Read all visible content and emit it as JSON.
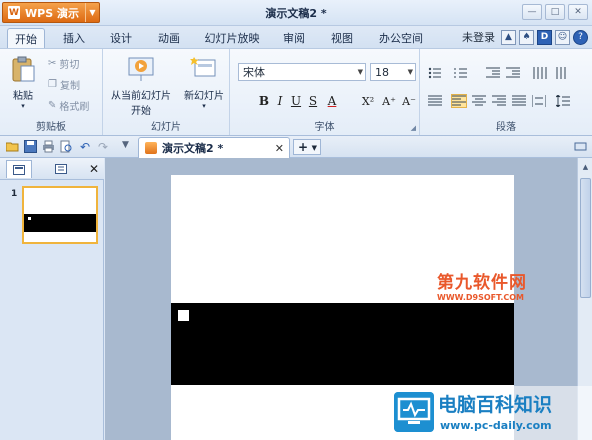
{
  "app": {
    "name": "WPS 演示",
    "logo_letter": "W"
  },
  "window": {
    "title": "演示文稿2 *"
  },
  "ribbon_tabs": [
    {
      "label": "开始",
      "active": true
    },
    {
      "label": "插入"
    },
    {
      "label": "设计"
    },
    {
      "label": "动画"
    },
    {
      "label": "幻灯片放映"
    },
    {
      "label": "审阅"
    },
    {
      "label": "视图"
    },
    {
      "label": "办公空间"
    }
  ],
  "user": {
    "login_label": "未登录"
  },
  "clipboard": {
    "paste": "粘贴",
    "cut": "剪切",
    "copy": "复制",
    "format_painter": "格式刷",
    "label": "剪贴板"
  },
  "slides_group": {
    "play_from_current": "从当前幻灯片",
    "play_start": "开始",
    "new_slide": "新幻灯片",
    "label": "幻灯片"
  },
  "font": {
    "name": "宋体",
    "size": "18",
    "label": "字体",
    "bold": "B",
    "italic": "I",
    "underline": "U",
    "strike": "S",
    "color": "A",
    "superscript": "X²",
    "grow": "A⁺",
    "shrink": "A⁻"
  },
  "paragraph": {
    "label": "段落"
  },
  "doc_tab": {
    "label": "演示文稿2 *"
  },
  "slide_panel": {
    "slide_number": "1"
  },
  "watermarks": {
    "top_title": "第九软件网",
    "top_url": "WWW.D9SOFT.COM",
    "bottom_title": "电脑百科知识",
    "bottom_url": "www.pc-daily.com"
  }
}
